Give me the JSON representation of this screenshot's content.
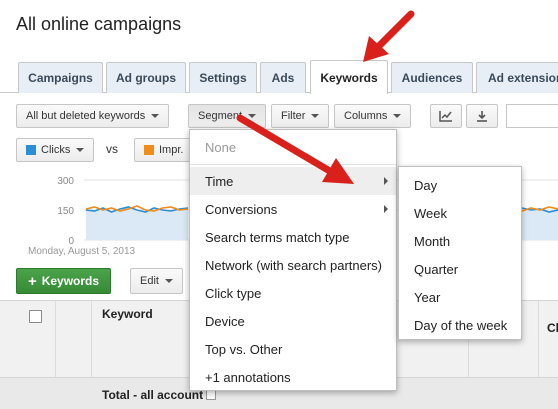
{
  "page": {
    "title": "All online campaigns"
  },
  "tabs": [
    {
      "label": "Campaigns"
    },
    {
      "label": "Ad groups"
    },
    {
      "label": "Settings"
    },
    {
      "label": "Ads"
    },
    {
      "label": "Keywords"
    },
    {
      "label": "Audiences"
    },
    {
      "label": "Ad extension"
    }
  ],
  "toolbar": {
    "filter_view": "All but deleted keywords",
    "segment": "Segment",
    "filter": "Filter",
    "columns": "Columns",
    "graph_icon": "line-chart-icon",
    "download_icon": "download-icon"
  },
  "metrics": {
    "metric1": "Clicks",
    "metric1_color": "#2b8fd6",
    "vs": "vs",
    "metric2": "Impr.",
    "metric2_color": "#f08c1c"
  },
  "chart_data": {
    "type": "line",
    "y_ticks": [
      "300",
      "150",
      "0"
    ],
    "ylim": [
      0,
      300
    ],
    "date_label": "Monday, August 5, 2013",
    "series": [
      {
        "values": [
          150,
          145,
          160,
          140,
          155,
          165,
          150,
          140,
          160,
          150,
          145,
          155,
          160
        ]
      },
      {
        "values": [
          155,
          165,
          150,
          160,
          145,
          155,
          170,
          150,
          145,
          160,
          165,
          150,
          155
        ]
      }
    ],
    "right_series": [
      {
        "values": [
          160,
          150,
          155,
          140,
          150
        ]
      },
      {
        "values": [
          145,
          160,
          150,
          165,
          155
        ]
      }
    ],
    "colors": [
      "#2b8fd6",
      "#f08c1c"
    ]
  },
  "actions": {
    "add_keywords": "Keywords",
    "add_icon": "+",
    "edit": "Edit"
  },
  "table": {
    "keyword_header": "Keyword",
    "total_row": "Total - all account",
    "right_header_fragment": "Cl"
  },
  "segment_menu": {
    "items": [
      {
        "label": "None",
        "disabled": true
      },
      {
        "label": "Time",
        "has_submenu": true
      },
      {
        "label": "Conversions",
        "has_submenu": true
      },
      {
        "label": "Search terms match type"
      },
      {
        "label": "Network (with search partners)"
      },
      {
        "label": "Click type"
      },
      {
        "label": "Device"
      },
      {
        "label": "Top vs. Other"
      },
      {
        "label": "+1 annotations"
      }
    ]
  },
  "time_submenu": {
    "items": [
      {
        "label": "Day"
      },
      {
        "label": "Week"
      },
      {
        "label": "Month"
      },
      {
        "label": "Quarter"
      },
      {
        "label": "Year"
      },
      {
        "label": "Day of the week"
      }
    ]
  }
}
